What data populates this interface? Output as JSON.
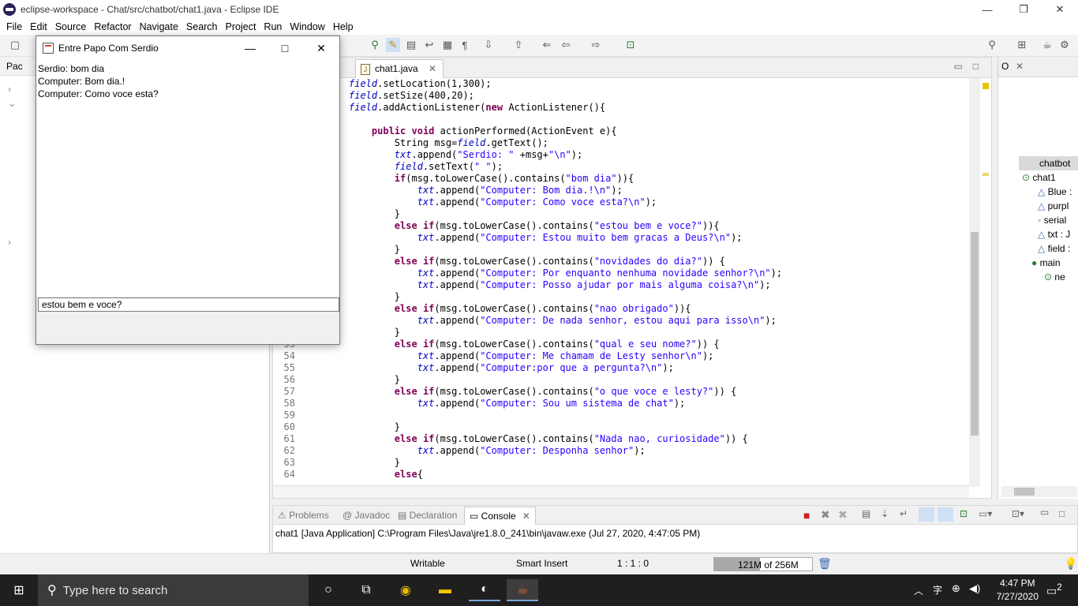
{
  "window": {
    "title": "eclipse-workspace - Chat/src/chatbot/chat1.java - Eclipse IDE",
    "minimize": "—",
    "maximize": "❐",
    "close": "✕"
  },
  "menu": [
    "File",
    "Edit",
    "Source",
    "Refactor",
    "Navigate",
    "Search",
    "Project",
    "Run",
    "Window",
    "Help"
  ],
  "package_explorer": {
    "tab_label": "Pac"
  },
  "editor": {
    "tab_label": "chat1.java",
    "tab_close": "✕",
    "lines": [
      {
        "n": "",
        "parts": [
          [
            "fld",
            "field"
          ],
          [
            "",
            "."
          ],
          [
            "",
            "setLocation(1,300);"
          ]
        ]
      },
      {
        "n": "",
        "parts": [
          [
            "fld",
            "field"
          ],
          [
            "",
            "."
          ],
          [
            "",
            "setSize(400,20);"
          ]
        ]
      },
      {
        "n": "",
        "parts": [
          [
            "fld",
            "field"
          ],
          [
            "",
            ".addActionListener("
          ],
          [
            "kw",
            "new"
          ],
          [
            "",
            " ActionListener(){"
          ]
        ]
      },
      {
        "n": "",
        "parts": [
          [
            "",
            ""
          ]
        ]
      },
      {
        "n": "",
        "parts": [
          [
            "",
            "    "
          ],
          [
            "kw",
            "public"
          ],
          [
            "",
            " "
          ],
          [
            "kw",
            "void"
          ],
          [
            "",
            " actionPerformed(ActionEvent e){"
          ]
        ]
      },
      {
        "n": "",
        "parts": [
          [
            "",
            "        String msg="
          ],
          [
            "fld",
            "field"
          ],
          [
            "",
            ".getText();"
          ]
        ]
      },
      {
        "n": "",
        "parts": [
          [
            "",
            "        "
          ],
          [
            "fld",
            "txt"
          ],
          [
            "",
            ".append("
          ],
          [
            "str",
            "\"Serdio: \""
          ],
          [
            "",
            " +msg+"
          ],
          [
            "str",
            "\"\\n\""
          ],
          [
            "",
            ");"
          ]
        ]
      },
      {
        "n": "",
        "parts": [
          [
            "",
            "        "
          ],
          [
            "fld",
            "field"
          ],
          [
            "",
            ".setText("
          ],
          [
            "str",
            "\" \""
          ],
          [
            "",
            ");"
          ]
        ]
      },
      {
        "n": "",
        "parts": [
          [
            "",
            "        "
          ],
          [
            "kw",
            "if"
          ],
          [
            "",
            "(msg.toLowerCase().contains("
          ],
          [
            "str",
            "\"bom dia\""
          ],
          [
            "",
            "))"
          ],
          [
            "",
            "{"
          ]
        ]
      },
      {
        "n": "",
        "parts": [
          [
            "",
            "            "
          ],
          [
            "fld",
            "txt"
          ],
          [
            "",
            ".append("
          ],
          [
            "str",
            "\"Computer: Bom dia.!\\n\""
          ],
          [
            "",
            ");"
          ]
        ]
      },
      {
        "n": "",
        "parts": [
          [
            "",
            "            "
          ],
          [
            "fld",
            "txt"
          ],
          [
            "",
            ".append("
          ],
          [
            "str",
            "\"Computer: Como voce esta?\\n\""
          ],
          [
            "",
            ");"
          ]
        ]
      },
      {
        "n": "",
        "parts": [
          [
            "",
            "        }"
          ]
        ]
      },
      {
        "n": "",
        "parts": [
          [
            "",
            "        "
          ],
          [
            "kw",
            "else"
          ],
          [
            "",
            " "
          ],
          [
            "kw",
            "if"
          ],
          [
            "",
            "(msg.toLowerCase().contains("
          ],
          [
            "str",
            "\"estou bem e voce?\""
          ],
          [
            "",
            "))"
          ],
          [
            "",
            "{"
          ]
        ]
      },
      {
        "n": "",
        "parts": [
          [
            "",
            "            "
          ],
          [
            "fld",
            "txt"
          ],
          [
            "",
            ".append("
          ],
          [
            "str",
            "\"Computer: Estou muito bem gracas a Deus?\\n\""
          ],
          [
            "",
            ");"
          ]
        ]
      },
      {
        "n": "",
        "parts": [
          [
            "",
            "        }"
          ]
        ]
      },
      {
        "n": "",
        "parts": [
          [
            "",
            "        "
          ],
          [
            "kw",
            "else"
          ],
          [
            "",
            " "
          ],
          [
            "kw",
            "if"
          ],
          [
            "",
            "(msg.toLowerCase().contains("
          ],
          [
            "str",
            "\"novidades do dia?\""
          ],
          [
            "",
            ")) {"
          ]
        ]
      },
      {
        "n": "",
        "parts": [
          [
            "",
            "            "
          ],
          [
            "fld",
            "txt"
          ],
          [
            "",
            ".append("
          ],
          [
            "str",
            "\"Computer: Por enquanto nenhuma novidade senhor?\\n\""
          ],
          [
            "",
            ");"
          ]
        ]
      },
      {
        "n": "",
        "parts": [
          [
            "",
            "            "
          ],
          [
            "fld",
            "txt"
          ],
          [
            "",
            ".append("
          ],
          [
            "str",
            "\"Computer: Posso ajudar por mais alguma coisa?\\n\""
          ],
          [
            "",
            ");"
          ]
        ]
      },
      {
        "n": "",
        "parts": [
          [
            "",
            "        }"
          ]
        ]
      },
      {
        "n": "",
        "parts": [
          [
            "",
            "        "
          ],
          [
            "kw",
            "else"
          ],
          [
            "",
            " "
          ],
          [
            "kw",
            "if"
          ],
          [
            "",
            "(msg.toLowerCase().contains("
          ],
          [
            "str",
            "\"nao obrigado\""
          ],
          [
            "",
            "))"
          ],
          [
            "",
            "{"
          ]
        ]
      },
      {
        "n": "",
        "parts": [
          [
            "",
            "            "
          ],
          [
            "fld",
            "txt"
          ],
          [
            "",
            ".append("
          ],
          [
            "str",
            "\"Computer: De nada senhor, estou aqui para isso\\n\""
          ],
          [
            "",
            ");"
          ]
        ]
      },
      {
        "n": "",
        "parts": [
          [
            "",
            "        }"
          ]
        ]
      },
      {
        "n": "53",
        "parts": [
          [
            "",
            "        "
          ],
          [
            "kw",
            "else"
          ],
          [
            "",
            " "
          ],
          [
            "kw",
            "if"
          ],
          [
            "",
            "(msg.toLowerCase().contains("
          ],
          [
            "str",
            "\"qual e seu nome?\""
          ],
          [
            "",
            ")) {"
          ]
        ]
      },
      {
        "n": "54",
        "parts": [
          [
            "",
            "            "
          ],
          [
            "fld",
            "txt"
          ],
          [
            "",
            ".append("
          ],
          [
            "str",
            "\"Computer: Me chamam de Lesty senhor\\n\""
          ],
          [
            "",
            ");"
          ]
        ]
      },
      {
        "n": "55",
        "parts": [
          [
            "",
            "            "
          ],
          [
            "fld",
            "txt"
          ],
          [
            "",
            ".append("
          ],
          [
            "str",
            "\"Computer:por que a pergunta?\\n\""
          ],
          [
            "",
            ");"
          ]
        ]
      },
      {
        "n": "56",
        "parts": [
          [
            "",
            "        }"
          ]
        ]
      },
      {
        "n": "57",
        "parts": [
          [
            "",
            "        "
          ],
          [
            "kw",
            "else"
          ],
          [
            "",
            " "
          ],
          [
            "kw",
            "if"
          ],
          [
            "",
            "(msg.toLowerCase().contains("
          ],
          [
            "str",
            "\"o que voce e lesty?\""
          ],
          [
            "",
            ")) {"
          ]
        ]
      },
      {
        "n": "58",
        "parts": [
          [
            "",
            "            "
          ],
          [
            "fld",
            "txt"
          ],
          [
            "",
            ".append("
          ],
          [
            "str",
            "\"Computer: Sou um sistema de chat\""
          ],
          [
            "",
            ");"
          ]
        ]
      },
      {
        "n": "59",
        "parts": [
          [
            "",
            ""
          ]
        ]
      },
      {
        "n": "60",
        "parts": [
          [
            "",
            "        }"
          ]
        ]
      },
      {
        "n": "61",
        "parts": [
          [
            "",
            "        "
          ],
          [
            "kw",
            "else"
          ],
          [
            "",
            " "
          ],
          [
            "kw",
            "if"
          ],
          [
            "",
            "(msg.toLowerCase().contains("
          ],
          [
            "str",
            "\"Nada nao, curiosidade\""
          ],
          [
            "",
            ")) {"
          ]
        ]
      },
      {
        "n": "62",
        "parts": [
          [
            "",
            "            "
          ],
          [
            "fld",
            "txt"
          ],
          [
            "",
            ".append("
          ],
          [
            "str",
            "\"Computer: Desponha senhor\""
          ],
          [
            "",
            ");"
          ]
        ]
      },
      {
        "n": "63",
        "parts": [
          [
            "",
            "        }"
          ]
        ]
      },
      {
        "n": "64",
        "parts": [
          [
            "",
            "        "
          ],
          [
            "kw",
            "else"
          ],
          [
            "",
            "{"
          ]
        ]
      }
    ]
  },
  "outline": {
    "items": [
      {
        "label": "chatbot",
        "indent": 0
      },
      {
        "label": "chat1",
        "indent": 1
      },
      {
        "label": "Blue :",
        "indent": 2
      },
      {
        "label": "purpl",
        "indent": 2
      },
      {
        "label": "serial",
        "indent": 2
      },
      {
        "label": "txt : J",
        "indent": 2
      },
      {
        "label": "field :",
        "indent": 2
      },
      {
        "label": "main",
        "indent": 2
      },
      {
        "label": "ne",
        "indent": 3
      }
    ]
  },
  "console": {
    "tabs": [
      "Problems",
      "Javadoc",
      "Declaration",
      "Console"
    ],
    "active_tab": "Console",
    "output": "chat1 [Java Application] C:\\Program Files\\Java\\jre1.8.0_241\\bin\\javaw.exe (Jul 27, 2020, 4:47:05 PM)"
  },
  "statusbar": {
    "writable": "Writable",
    "insert_mode": "Smart Insert",
    "position": "1 : 1 : 0",
    "heap_used": "121M",
    "heap_total": "of 256M",
    "heap_fraction": 0.47
  },
  "chat_window": {
    "title": "Entre Papo Com Serdio",
    "messages": [
      "Serdio: bom dia",
      "Computer: Bom dia.!",
      "Computer: Como voce esta?"
    ],
    "input_value": "estou bem e voce?"
  },
  "taskbar": {
    "search_placeholder": "Type here to search",
    "time": "4:47 PM",
    "date": "7/27/2020",
    "notification_count": "2"
  }
}
